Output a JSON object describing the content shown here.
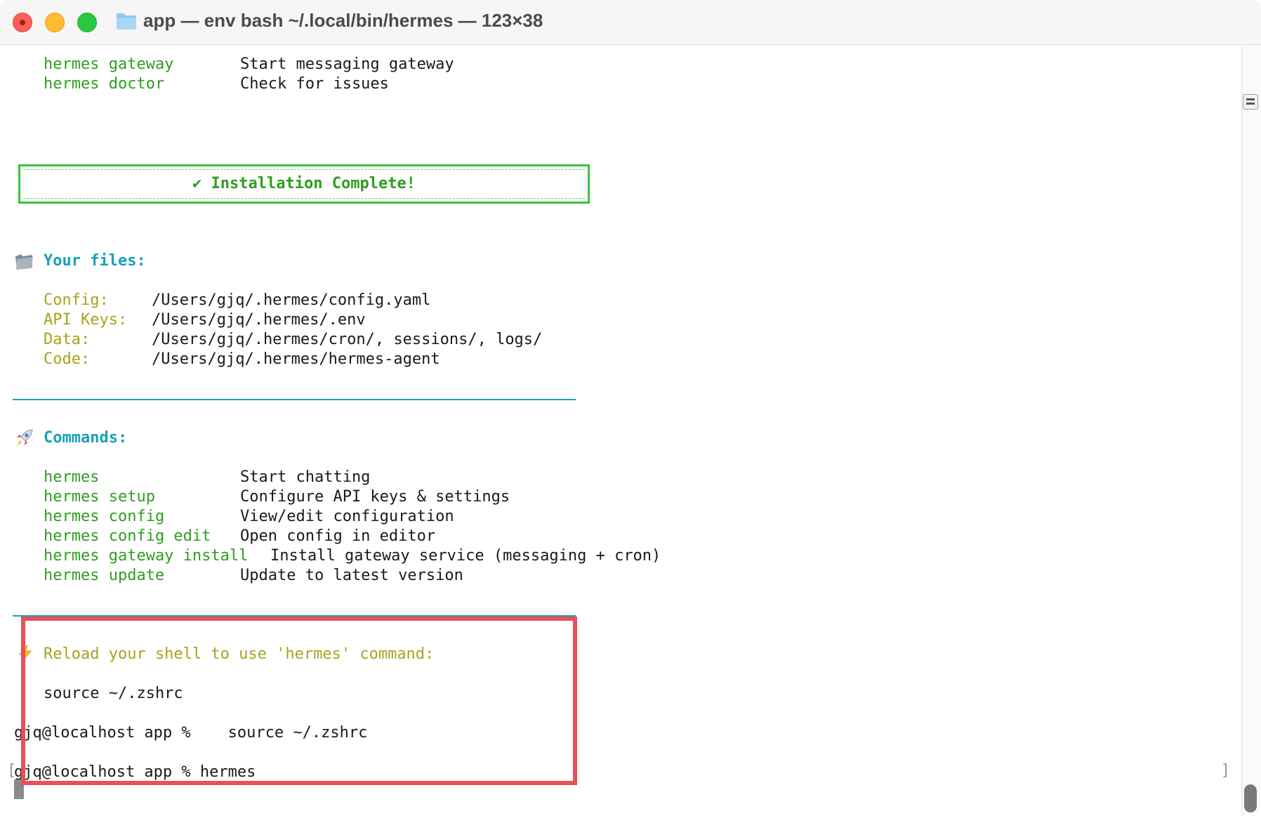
{
  "window": {
    "title": "app — env bash ~/.local/bin/hermes — 123×38"
  },
  "top_commands": [
    {
      "cmd": "hermes gateway",
      "desc": "Start messaging gateway"
    },
    {
      "cmd": "hermes doctor",
      "desc": "Check for issues"
    }
  ],
  "install_banner": "✔ Installation Complete!",
  "files": {
    "heading": "Your files:",
    "items": [
      {
        "label": "Config:",
        "value": "/Users/gjq/.hermes/config.yaml"
      },
      {
        "label": "API Keys:",
        "value": "/Users/gjq/.hermes/.env"
      },
      {
        "label": "Data:",
        "value": "/Users/gjq/.hermes/cron/, sessions/, logs/"
      },
      {
        "label": "Code:",
        "value": "/Users/gjq/.hermes/hermes-agent"
      }
    ]
  },
  "commands": {
    "heading": "Commands:",
    "items": [
      {
        "cmd": "hermes",
        "desc": "Start chatting"
      },
      {
        "cmd": "hermes setup",
        "desc": "Configure API keys & settings"
      },
      {
        "cmd": "hermes config",
        "desc": "View/edit configuration"
      },
      {
        "cmd": "hermes config edit",
        "desc": "Open config in editor"
      },
      {
        "cmd": "hermes gateway install",
        "desc": "Install gateway service (messaging + cron)"
      },
      {
        "cmd": "hermes update",
        "desc": "Update to latest version"
      }
    ]
  },
  "reload": {
    "message": "Reload your shell to use 'hermes' command:",
    "source_cmd": "source ~/.zshrc"
  },
  "prompts": [
    {
      "prompt": "gjq@localhost app % ",
      "input": "   source ~/.zshrc"
    },
    {
      "prompt": "gjq@localhost app % ",
      "input": "hermes"
    }
  ],
  "colors": {
    "command_green": "#2e9e1f",
    "label_olive": "#a8a31c",
    "heading_cyan": "#1aa0b8",
    "highlight_red": "#e8505a",
    "banner_border": "#3cc53c"
  },
  "icons": {
    "folder": "folder-icon",
    "files": "file-folder-icon",
    "commands": "rocket-icon",
    "reload": "lightning-icon"
  }
}
